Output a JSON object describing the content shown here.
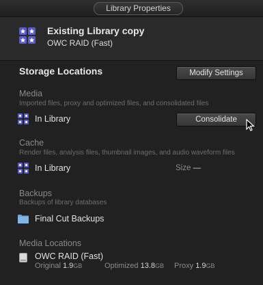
{
  "window": {
    "title": "Library Properties"
  },
  "library": {
    "name": "Existing Library copy",
    "location": "OWC RAID (Fast)",
    "icon": "library-icon"
  },
  "storage": {
    "title": "Storage Locations",
    "modify_label": "Modify Settings"
  },
  "media": {
    "title": "Media",
    "description": "Imported files, proxy and optimized files, and consolidated files",
    "location": "In Library",
    "consolidate_label": "Consolidate"
  },
  "cache": {
    "title": "Cache",
    "description": "Render files, analysis files, thumbnail images, and audio waveform files",
    "location": "In Library",
    "size_label": "Size",
    "size_value": "—"
  },
  "backups": {
    "title": "Backups",
    "description": "Backups of library databases",
    "location": "Final Cut Backups"
  },
  "media_locations": {
    "title": "Media Locations",
    "drive_name": "OWC RAID (Fast)",
    "original_label": "Original",
    "original_value": "1.9",
    "original_unit": "GB",
    "optimized_label": "Optimized",
    "optimized_value": "13.8",
    "optimized_unit": "GB",
    "proxy_label": "Proxy",
    "proxy_value": "1.9",
    "proxy_unit": "GB"
  },
  "colors": {
    "background": "#212121",
    "library_icon": "#4a4ab8",
    "folder": "#6ea2d8"
  }
}
